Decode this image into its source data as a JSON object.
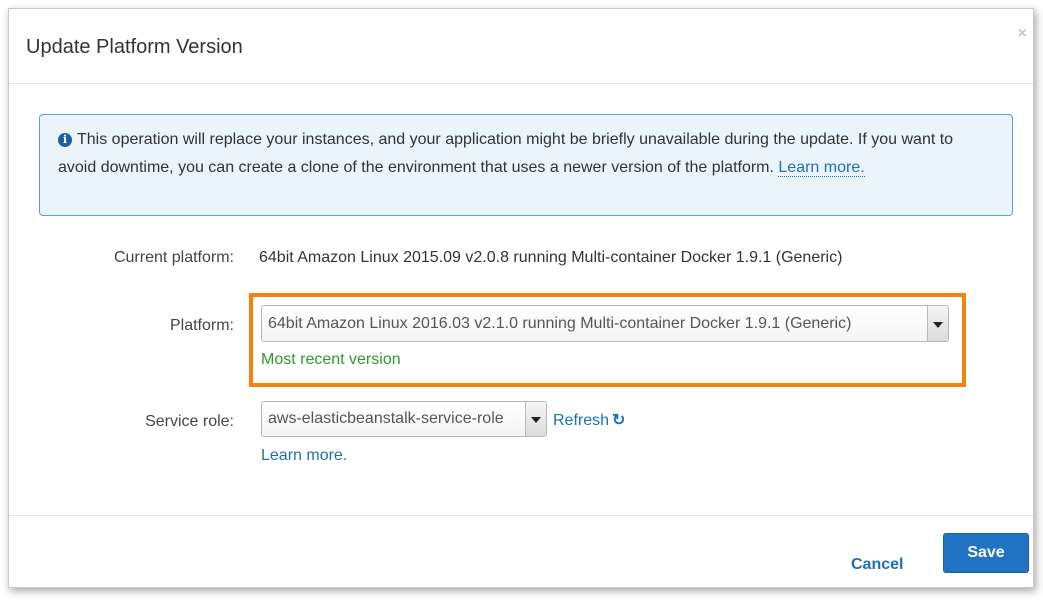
{
  "dialog": {
    "title": "Update Platform Version",
    "close_symbol": "×"
  },
  "alert": {
    "icon": "info-icon",
    "icon_glyph": "i",
    "message": "This operation will replace your instances, and your application might be briefly unavailable during the update. If you want to avoid downtime, you can create a clone of the environment that uses a newer version of the platform.",
    "link_label": "Learn more."
  },
  "form": {
    "current_platform": {
      "label": "Current platform:",
      "value": "64bit Amazon Linux 2015.09 v2.0.8 running Multi-container Docker 1.9.1 (Generic)"
    },
    "platform": {
      "label": "Platform:",
      "selected": "64bit Amazon Linux 2016.03 v2.1.0 running Multi-container Docker 1.9.1 (Generic)",
      "hint": "Most recent version"
    },
    "service_role": {
      "label": "Service role:",
      "selected": "aws-elasticbeanstalk-service-role",
      "refresh_label": "Refresh",
      "refresh_icon": "refresh-icon",
      "learn_more_label": "Learn more."
    }
  },
  "footer": {
    "cancel_label": "Cancel",
    "save_label": "Save"
  },
  "colors": {
    "highlight": "#f28411",
    "primary": "#2174c4",
    "link": "#1f6fb5",
    "success": "#2e9a2e",
    "alert_bg": "#eaf4fb"
  }
}
